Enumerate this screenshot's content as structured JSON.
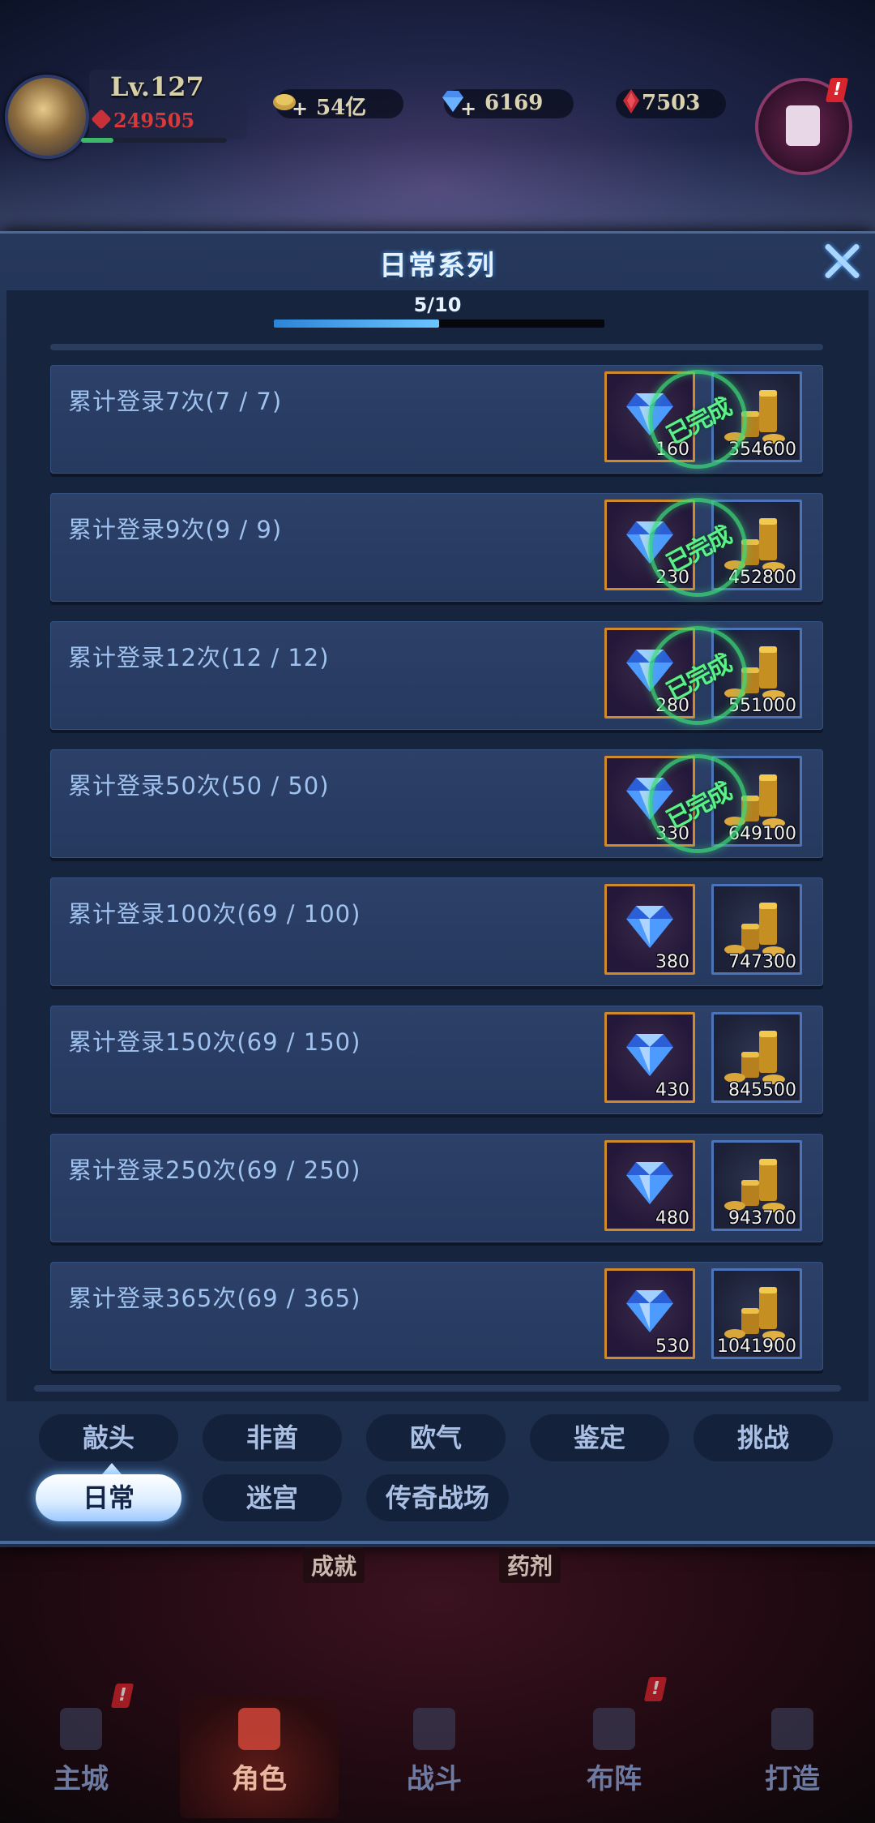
{
  "player": {
    "level": "Lv.127",
    "power": "249505"
  },
  "resources": [
    {
      "name": "gold",
      "value": "54亿",
      "color": "#d9b24a"
    },
    {
      "name": "diamond",
      "value": "6169",
      "color": "#5aa8ff"
    },
    {
      "name": "ruby",
      "value": "7503",
      "color": "#d2333a"
    }
  ],
  "panel": {
    "title": "日常系列",
    "progress_text": "5/10",
    "progress_fraction": 0.5
  },
  "tasks": [
    {
      "label": "累计登录7次(7 / 7)",
      "gem": "160",
      "gold": "354600",
      "completed": true,
      "stamp": "已完成"
    },
    {
      "label": "累计登录9次(9 / 9)",
      "gem": "230",
      "gold": "452800",
      "completed": true,
      "stamp": "已完成"
    },
    {
      "label": "累计登录12次(12 / 12)",
      "gem": "280",
      "gold": "551000",
      "completed": true,
      "stamp": "已完成"
    },
    {
      "label": "累计登录50次(50 / 50)",
      "gem": "330",
      "gold": "649100",
      "completed": true,
      "stamp": "已完成"
    },
    {
      "label": "累计登录100次(69 / 100)",
      "gem": "380",
      "gold": "747300",
      "completed": false
    },
    {
      "label": "累计登录150次(69 / 150)",
      "gem": "430",
      "gold": "845500",
      "completed": false
    },
    {
      "label": "累计登录250次(69 / 250)",
      "gem": "480",
      "gold": "943700",
      "completed": false
    },
    {
      "label": "累计登录365次(69 / 365)",
      "gem": "530",
      "gold": "1041900",
      "completed": false
    }
  ],
  "tabs": {
    "row1": [
      "敲头",
      "非酋",
      "欧气",
      "鉴定",
      "挑战"
    ],
    "row2": [
      "日常",
      "迷宫",
      "传奇战场"
    ],
    "active": "日常"
  },
  "under_labels": [
    "成就",
    "药剂"
  ],
  "bottom_nav": [
    "主城",
    "角色",
    "战斗",
    "布阵",
    "打造"
  ],
  "bottom_nav_active": "角色",
  "alert_mark": "!"
}
